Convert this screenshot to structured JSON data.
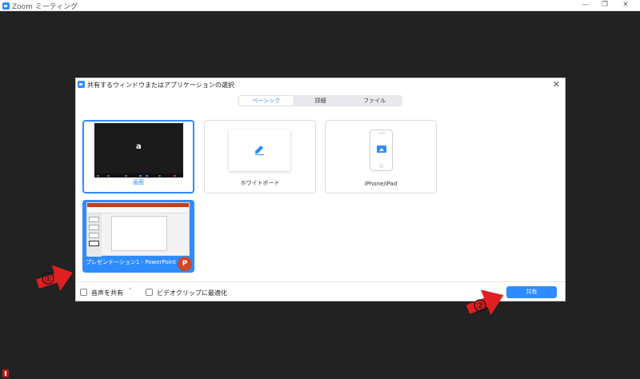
{
  "window": {
    "title": "Zoom ミーティング",
    "controls": {
      "minimize": "—",
      "restore": "❐",
      "close": "✕"
    }
  },
  "dialog": {
    "title": "共有するウィンドウまたはアプリケーションの選択",
    "close": "✕",
    "tabs": [
      {
        "label": "ベーシック",
        "active": true
      },
      {
        "label": "詳細",
        "active": false
      },
      {
        "label": "ファイル",
        "active": false
      }
    ],
    "tiles": {
      "screen": {
        "label": "画面",
        "thumb_letter": "a"
      },
      "whiteboard": {
        "label": "ホワイトボード"
      },
      "iphone": {
        "label": "iPhone/iPad"
      },
      "powerpoint": {
        "label": "プレゼンテーション1 - PowerPoint",
        "app_icon_letter": "P"
      }
    },
    "footer": {
      "share_audio": "音声を共有",
      "share_audio_dropdown": "˅",
      "optimize_video": "ビデオクリップに最適化",
      "share_button": "共有"
    }
  },
  "annotations": [
    {
      "number": "①"
    },
    {
      "number": "②"
    }
  ],
  "colors": {
    "accent": "#2d8cff",
    "background": "#222222",
    "arrow": "#e02020"
  }
}
